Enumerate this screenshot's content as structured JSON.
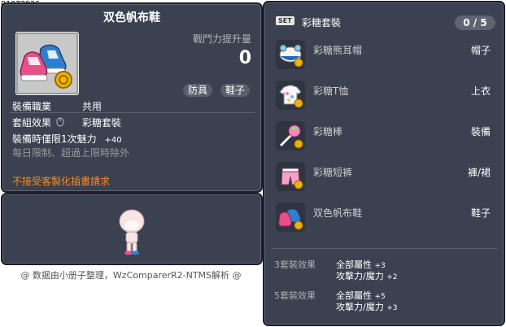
{
  "item_id": "01072926",
  "item": {
    "name": "双色帆布鞋",
    "combat_label": "戰鬥力提升量",
    "combat_value": "0",
    "tags": [
      "防具",
      "鞋子"
    ],
    "job_label": "裝備職業",
    "job_value": "共用",
    "set_label": "套組效果",
    "set_value": "彩糖套裝",
    "charm_text": "裝備時僅限1次魅力",
    "charm_value": "+40",
    "limit_text": "每日限制、超過上限時除外",
    "warning_text": "不接受客製化插畫請求"
  },
  "credit": "@ 数据由小册子整理，WzComparerR2-NTMS解析 @",
  "set": {
    "badge": "SET",
    "name": "彩糖套裝",
    "count": "0 / 5",
    "items": [
      {
        "name": "彩糖熊耳帽",
        "slot": "帽子",
        "icon": "hat-icon"
      },
      {
        "name": "彩糖T恤",
        "slot": "上衣",
        "icon": "shirt-icon"
      },
      {
        "name": "彩糖棒",
        "slot": "裝備",
        "icon": "wand-icon"
      },
      {
        "name": "彩糖短裤",
        "slot": "褲/裙",
        "icon": "shorts-icon"
      },
      {
        "name": "双色帆布鞋",
        "slot": "鞋子",
        "icon": "shoes-icon"
      }
    ],
    "effects": [
      {
        "label": "3套裝效果",
        "lines": [
          {
            "stat": "全部屬性",
            "value": "+3"
          },
          {
            "stat": "攻擊力/魔力",
            "value": "+2"
          }
        ]
      },
      {
        "label": "5套裝效果",
        "lines": [
          {
            "stat": "全部屬性",
            "value": "+5"
          },
          {
            "stat": "攻擊力/魔力",
            "value": "+3"
          }
        ]
      }
    ]
  },
  "colors": {
    "panel": "#3b4150",
    "warning": "#ff8c1a",
    "coin": "#f0b400"
  }
}
